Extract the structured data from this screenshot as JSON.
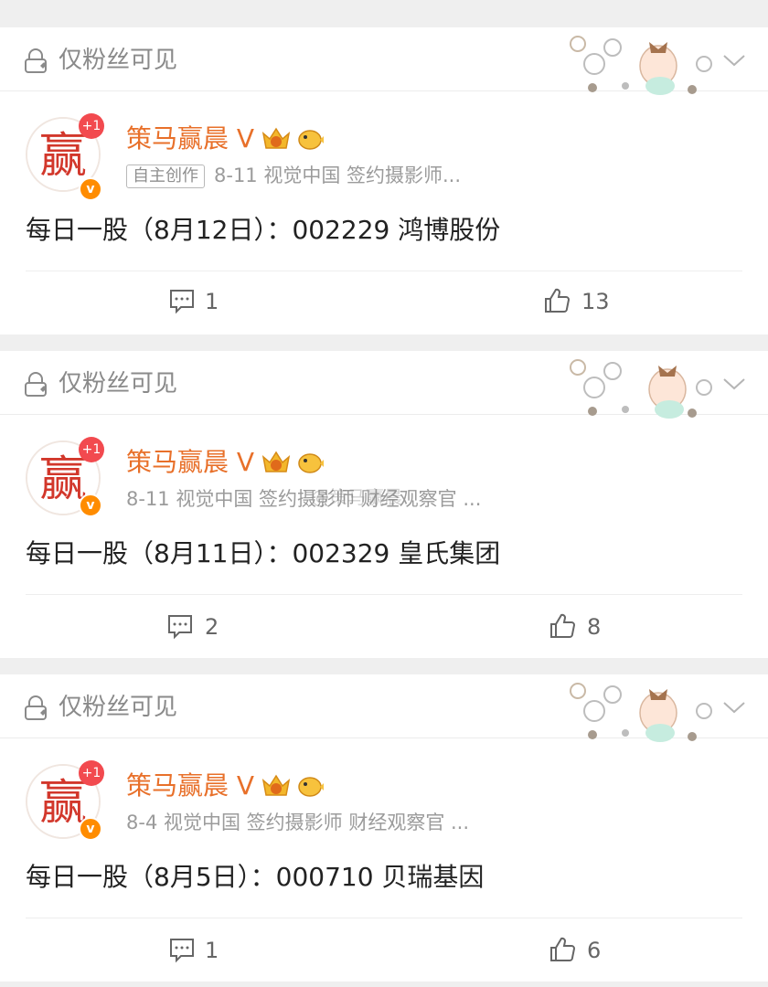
{
  "visibility_label": "仅粉丝可见",
  "user": {
    "name": "策马赢晨",
    "v_mark": "V",
    "notif_badge": "+1",
    "verified_mark": "v",
    "avatar_glyph": "赢"
  },
  "watermark": "@策马赢晨",
  "colors": {
    "username": "#e8702a",
    "badge_red": "#f24a4f",
    "verified_orange": "#ff8c00"
  },
  "posts": [
    {
      "tag": "自主创作",
      "meta": "8-11  视觉中国  签约摄影师...",
      "text": "每日一股（8月12日）：002229 鸿博股份",
      "comments": "1",
      "likes": "13"
    },
    {
      "tag": "",
      "meta": "8-11  视觉中国  签约摄影师  财经观察官 ...",
      "text": "每日一股（8月11日）：002329 皇氏集团",
      "comments": "2",
      "likes": "8"
    },
    {
      "tag": "",
      "meta": "8-4  视觉中国  签约摄影师  财经观察官 ...",
      "text": "每日一股（8月5日）：000710 贝瑞基因",
      "comments": "1",
      "likes": "6"
    }
  ]
}
